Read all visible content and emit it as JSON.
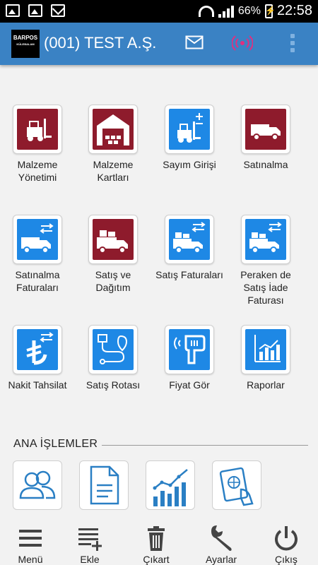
{
  "status_bar": {
    "battery": "66%",
    "time": "22:58",
    "icons": [
      "image-icon",
      "gallery-icon",
      "mail-icon",
      "wifi-icon",
      "signal-icon",
      "battery-icon"
    ]
  },
  "app_bar": {
    "logo_text": "BARPOS",
    "logo_sub": "KÜLEBALAM",
    "title": "(001) TEST A.Ş.",
    "icons": [
      "mail-icon",
      "live-signal-icon",
      "more-vert-icon"
    ],
    "colors": {
      "bar": "#3a82c4",
      "live": "#e03080"
    }
  },
  "tiles": [
    {
      "label": "Malzeme Yönetimi",
      "icon": "forklift-icon",
      "color": "#8e1b2c"
    },
    {
      "label": "Malzeme Kartları",
      "icon": "warehouse-icon",
      "color": "#8e1b2c"
    },
    {
      "label": "Sayım Girişi",
      "icon": "forklift-count-icon",
      "color": "#1e88e5"
    },
    {
      "label": "Satınalma",
      "icon": "truck-icon",
      "color": "#8e1b2c"
    },
    {
      "label": "Satınalma Faturaları",
      "icon": "truck-arrows-icon",
      "color": "#1e88e5"
    },
    {
      "label": "Satış ve Dağıtım",
      "icon": "loaded-truck-icon",
      "color": "#8e1b2c"
    },
    {
      "label": "Satış Faturaları",
      "icon": "loaded-truck-arrows-icon",
      "color": "#1e88e5"
    },
    {
      "label": "Peraken de Satış İade Faturası",
      "icon": "loaded-truck-arrows-icon",
      "color": "#1e88e5"
    },
    {
      "label": "Nakit Tahsilat",
      "icon": "lira-icon",
      "color": "#1e88e5"
    },
    {
      "label": "Satış Rotası",
      "icon": "route-icon",
      "color": "#1e88e5"
    },
    {
      "label": "Fiyat Gör",
      "icon": "barcode-scanner-icon",
      "color": "#1e88e5"
    },
    {
      "label": "Raporlar",
      "icon": "chart-icon",
      "color": "#1e88e5"
    }
  ],
  "section": {
    "title": "ANA İŞLEMLER"
  },
  "ana_tiles": [
    {
      "icon": "users-icon"
    },
    {
      "icon": "document-icon"
    },
    {
      "icon": "analytics-icon"
    },
    {
      "icon": "passport-icon"
    }
  ],
  "bottom_nav": [
    {
      "label": "Menü",
      "icon": "menu-icon"
    },
    {
      "label": "Ekle",
      "icon": "add-list-icon"
    },
    {
      "label": "Çıkart",
      "icon": "trash-icon"
    },
    {
      "label": "Ayarlar",
      "icon": "wrench-icon"
    },
    {
      "label": "Çıkış",
      "icon": "power-icon"
    }
  ]
}
